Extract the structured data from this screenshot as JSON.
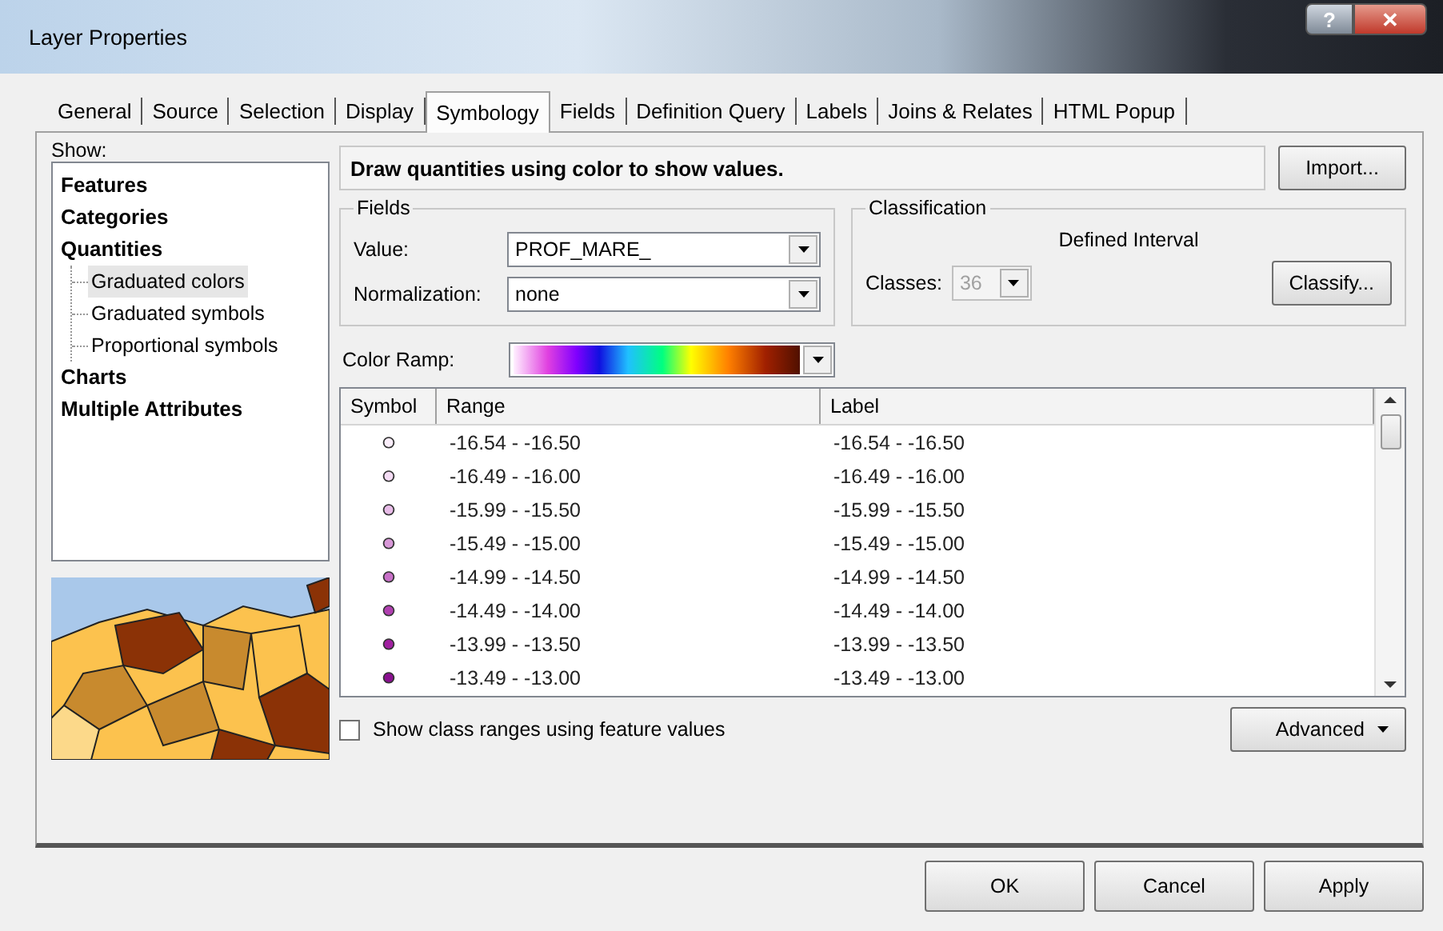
{
  "window": {
    "title": "Layer Properties",
    "help_button": "?",
    "close_button": "✕"
  },
  "tabs": [
    {
      "label": "General",
      "selected": false
    },
    {
      "label": "Source",
      "selected": false
    },
    {
      "label": "Selection",
      "selected": false
    },
    {
      "label": "Display",
      "selected": false
    },
    {
      "label": "Symbology",
      "selected": true
    },
    {
      "label": "Fields",
      "selected": false
    },
    {
      "label": "Definition Query",
      "selected": false
    },
    {
      "label": "Labels",
      "selected": false
    },
    {
      "label": "Joins & Relates",
      "selected": false
    },
    {
      "label": "HTML Popup",
      "selected": false
    }
  ],
  "show": {
    "label": "Show:",
    "items": [
      {
        "label": "Features",
        "selected": false
      },
      {
        "label": "Categories",
        "selected": false
      },
      {
        "label": "Quantities",
        "selected": false,
        "children": [
          {
            "label": "Graduated colors",
            "selected": true
          },
          {
            "label": "Graduated symbols",
            "selected": false
          },
          {
            "label": "Proportional symbols",
            "selected": false
          }
        ]
      },
      {
        "label": "Charts",
        "selected": false
      },
      {
        "label": "Multiple Attributes",
        "selected": false
      }
    ]
  },
  "description": "Draw quantities using color to show values.",
  "import_button": "Import...",
  "fields": {
    "title": "Fields",
    "value": {
      "label": "Value:",
      "value": "PROF_MARE_"
    },
    "normalization": {
      "label": "Normalization:",
      "value": "none"
    }
  },
  "classification": {
    "title": "Classification",
    "method": "Defined Interval",
    "classes": {
      "label": "Classes:",
      "value": "36",
      "disabled": true
    },
    "classify_button": "Classify..."
  },
  "color_ramp": {
    "label": "Color Ramp:"
  },
  "table": {
    "columns": [
      "Symbol",
      "Range",
      "Label"
    ],
    "rows": [
      {
        "color": "#fbeefb",
        "range": "-16.54 - -16.50",
        "label": "-16.54 - -16.50"
      },
      {
        "color": "#f4dcf4",
        "range": "-16.49 - -16.00",
        "label": "-16.49 - -16.00"
      },
      {
        "color": "#e8bce8",
        "range": "-15.99 - -15.50",
        "label": "-15.99 - -15.50"
      },
      {
        "color": "#d898d8",
        "range": "-15.49 - -15.00",
        "label": "-15.49 - -15.00"
      },
      {
        "color": "#c870c8",
        "range": "-14.99 - -14.50",
        "label": "-14.99 - -14.50"
      },
      {
        "color": "#b040b0",
        "range": "-14.49 - -14.00",
        "label": "-14.49 - -14.00"
      },
      {
        "color": "#a020a0",
        "range": "-13.99 - -13.50",
        "label": "-13.99 - -13.50"
      },
      {
        "color": "#8a1090",
        "range": "-13.49 - -13.00",
        "label": "-13.49 - -13.00"
      }
    ]
  },
  "show_class_ranges": {
    "label": "Show class ranges using feature values",
    "checked": false
  },
  "advanced_button": "Advanced",
  "buttons": [
    "OK",
    "Cancel",
    "Apply"
  ]
}
